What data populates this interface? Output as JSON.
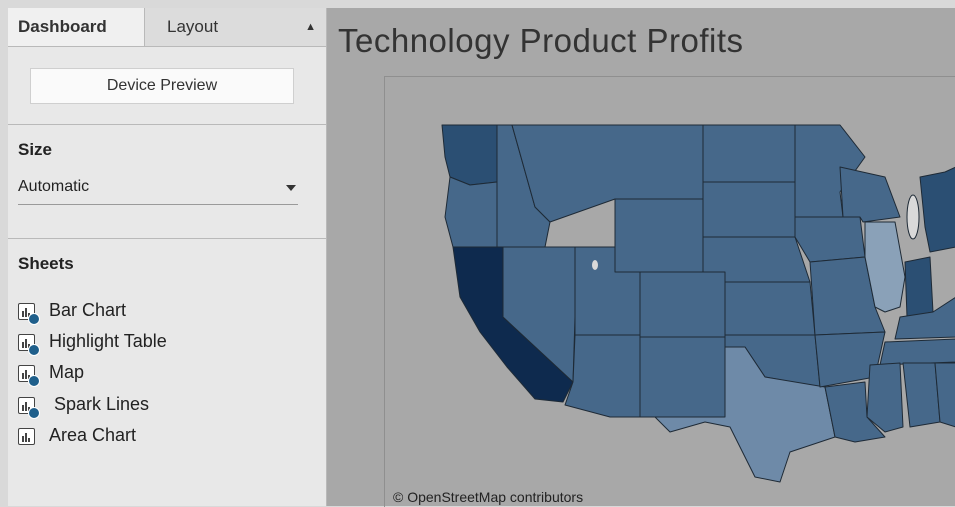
{
  "sidebar": {
    "tabs": {
      "dashboard": "Dashboard",
      "layout": "Layout",
      "layout_icon": "updown-arrows-icon"
    },
    "device_preview_label": "Device Preview",
    "size": {
      "title": "Size",
      "value": "Automatic"
    },
    "sheets": {
      "title": "Sheets",
      "items": [
        {
          "label": "Bar Chart",
          "icon": "sheet-icon",
          "in_use": true
        },
        {
          "label": "Highlight Table",
          "icon": "sheet-icon",
          "in_use": true
        },
        {
          "label": "Map",
          "icon": "sheet-icon",
          "in_use": true
        },
        {
          "label": " Spark Lines",
          "icon": "sheet-icon",
          "in_use": true
        },
        {
          "label": "Area Chart",
          "icon": "sheet-icon",
          "in_use": false
        }
      ]
    }
  },
  "main": {
    "title": "Technology Product Profits",
    "map": {
      "attribution": "© OpenStreetMap contributors",
      "colors": {
        "background": "#a8a8a8",
        "border": "#1e2a36",
        "darkest": "#0e2a4e",
        "dark": "#2b4f73",
        "medium": "#46688a",
        "light": "#6e8aa8",
        "lighter": "#8aa1b8"
      }
    }
  }
}
